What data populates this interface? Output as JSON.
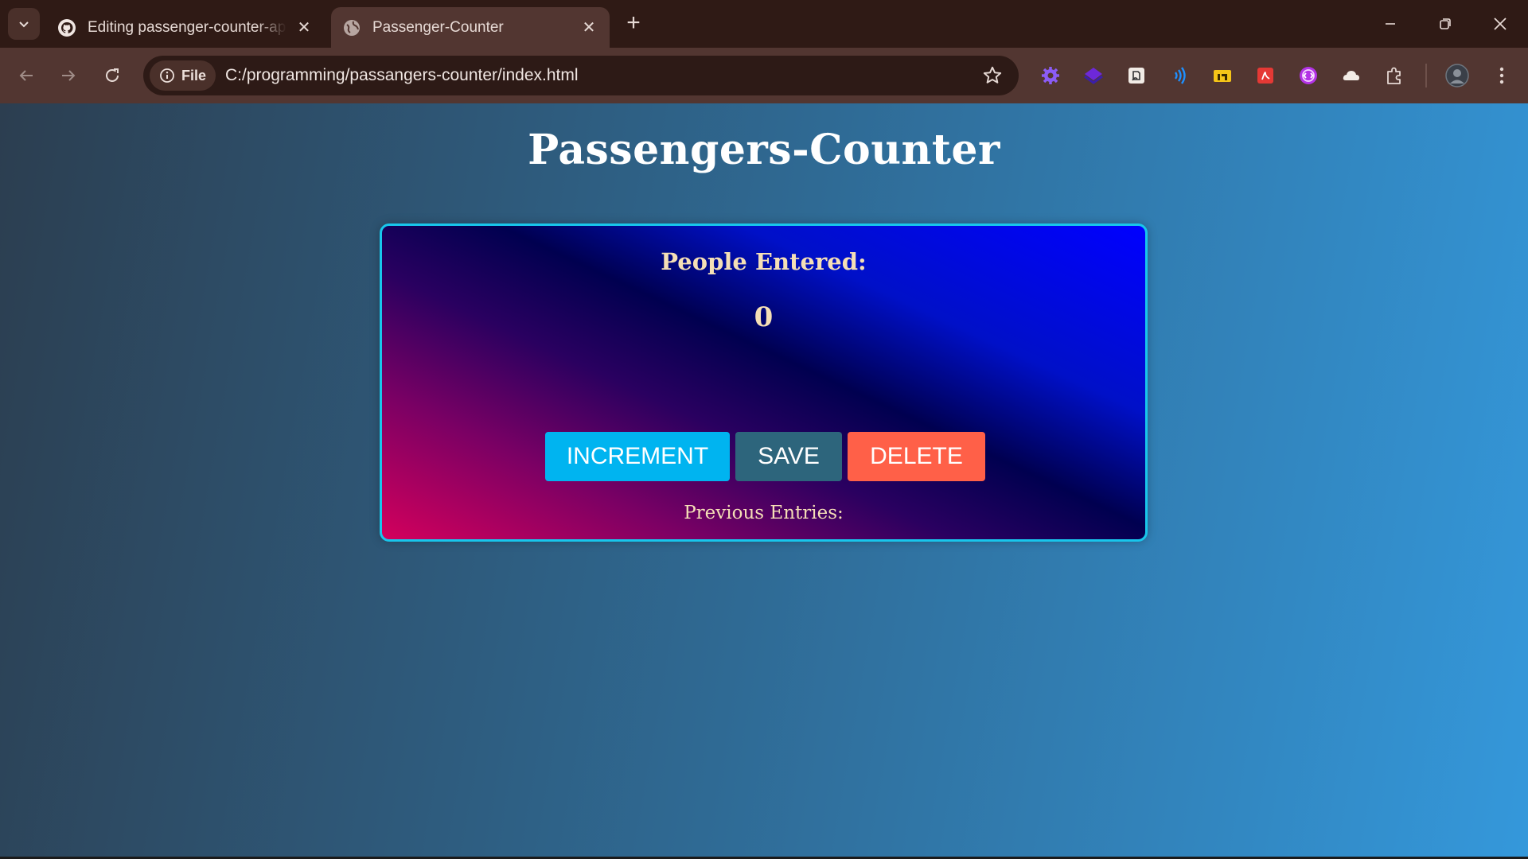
{
  "browser": {
    "tabs": [
      {
        "title": "Editing passenger-counter-app/",
        "favicon": "github-icon",
        "active": false
      },
      {
        "title": "Passenger-Counter",
        "favicon": "globe-icon",
        "active": true
      }
    ],
    "address_chip": "File",
    "url": "C:/programming/passangers-counter/index.html",
    "extensions": [
      "gear-extension-icon",
      "layers-extension-icon",
      "document-extension-icon",
      "signal-extension-icon",
      "folder-extension-icon",
      "pdf-extension-icon",
      "code-extension-icon",
      "cloud-extension-icon",
      "puzzle-icon"
    ]
  },
  "page": {
    "title": "Passengers-Counter",
    "heading": "People Entered:",
    "count": "0",
    "buttons": {
      "increment": "INCREMENT",
      "save": "SAVE",
      "delete": "DELETE"
    },
    "entries_label": "Previous Entries:"
  },
  "colors": {
    "increment": "#00b4f0",
    "save": "#2d657c",
    "delete": "#ff6048",
    "card_border": "#18c6ec",
    "text_accent": "#f5dfb6"
  }
}
